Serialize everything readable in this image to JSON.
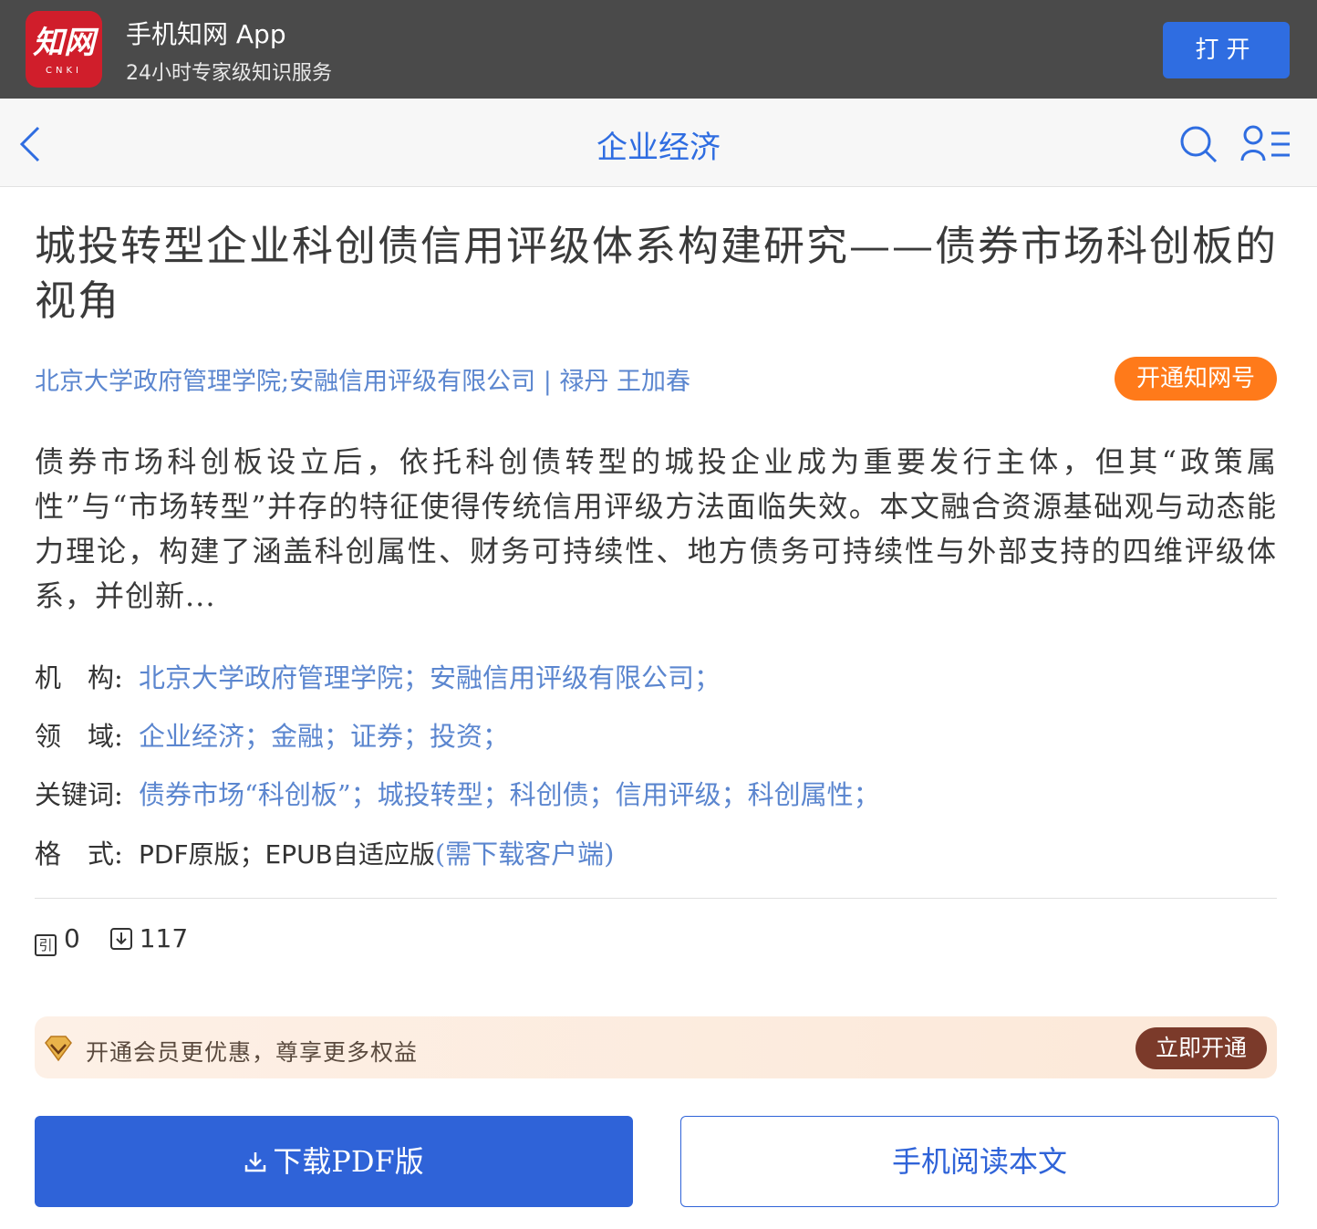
{
  "app_banner": {
    "logo_text": "知网",
    "logo_sub": "CNKI",
    "app_name": "手机知网 App",
    "slogan": "24小时专家级知识服务",
    "open_label": "打开"
  },
  "nav": {
    "title": "企业经济",
    "icons": [
      "back-icon",
      "search-icon",
      "user-menu-icon"
    ]
  },
  "article": {
    "title": "城投转型企业科创债信用评级体系构建研究——债券市场科创板的视角",
    "institutions_line": "北京大学政府管理学院;安融信用评级有限公司",
    "separator": "|",
    "authors": "禄丹 王加春",
    "vip_label": "开通知网号",
    "abstract": "债券市场科创板设立后，依托科创债转型的城投企业成为重要发行主体，但其“政策属性”与“市场转型”并存的特征使得传统信用评级方法面临失效。本文融合资源基础观与动态能力理论，构建了涵盖科创属性、财务可持续性、地方债务可持续性与外部支持的四维评级体系，并创新..."
  },
  "meta": {
    "institution_label": "机　构:",
    "institution_value": "北京大学政府管理学院；安融信用评级有限公司；",
    "field_label": "领　域:",
    "field_value": "企业经济；金融；证券；投资；",
    "keywords_label": "关键词:",
    "keywords_value": "债券市场“科创板”；城投转型；科创债；信用评级；科创属性；",
    "format_label": "格　式:",
    "format_value": "PDF原版；EPUB自适应版",
    "format_link": "(需下载客户端)"
  },
  "stats": {
    "cite_icon_text": "引",
    "cite_count": "0",
    "download_count": "117"
  },
  "member": {
    "text": "开通会员更优惠，尊享更多权益",
    "button": "立即开通"
  },
  "actions": {
    "download_label": "下载PDF版",
    "read_label": "手机阅读本文"
  },
  "colors": {
    "brand_red": "#d01e2b",
    "link_blue": "#5b86cf",
    "primary_blue": "#2f63d8",
    "orange": "#ff7a1a",
    "member_brown": "#7b3a2a"
  }
}
